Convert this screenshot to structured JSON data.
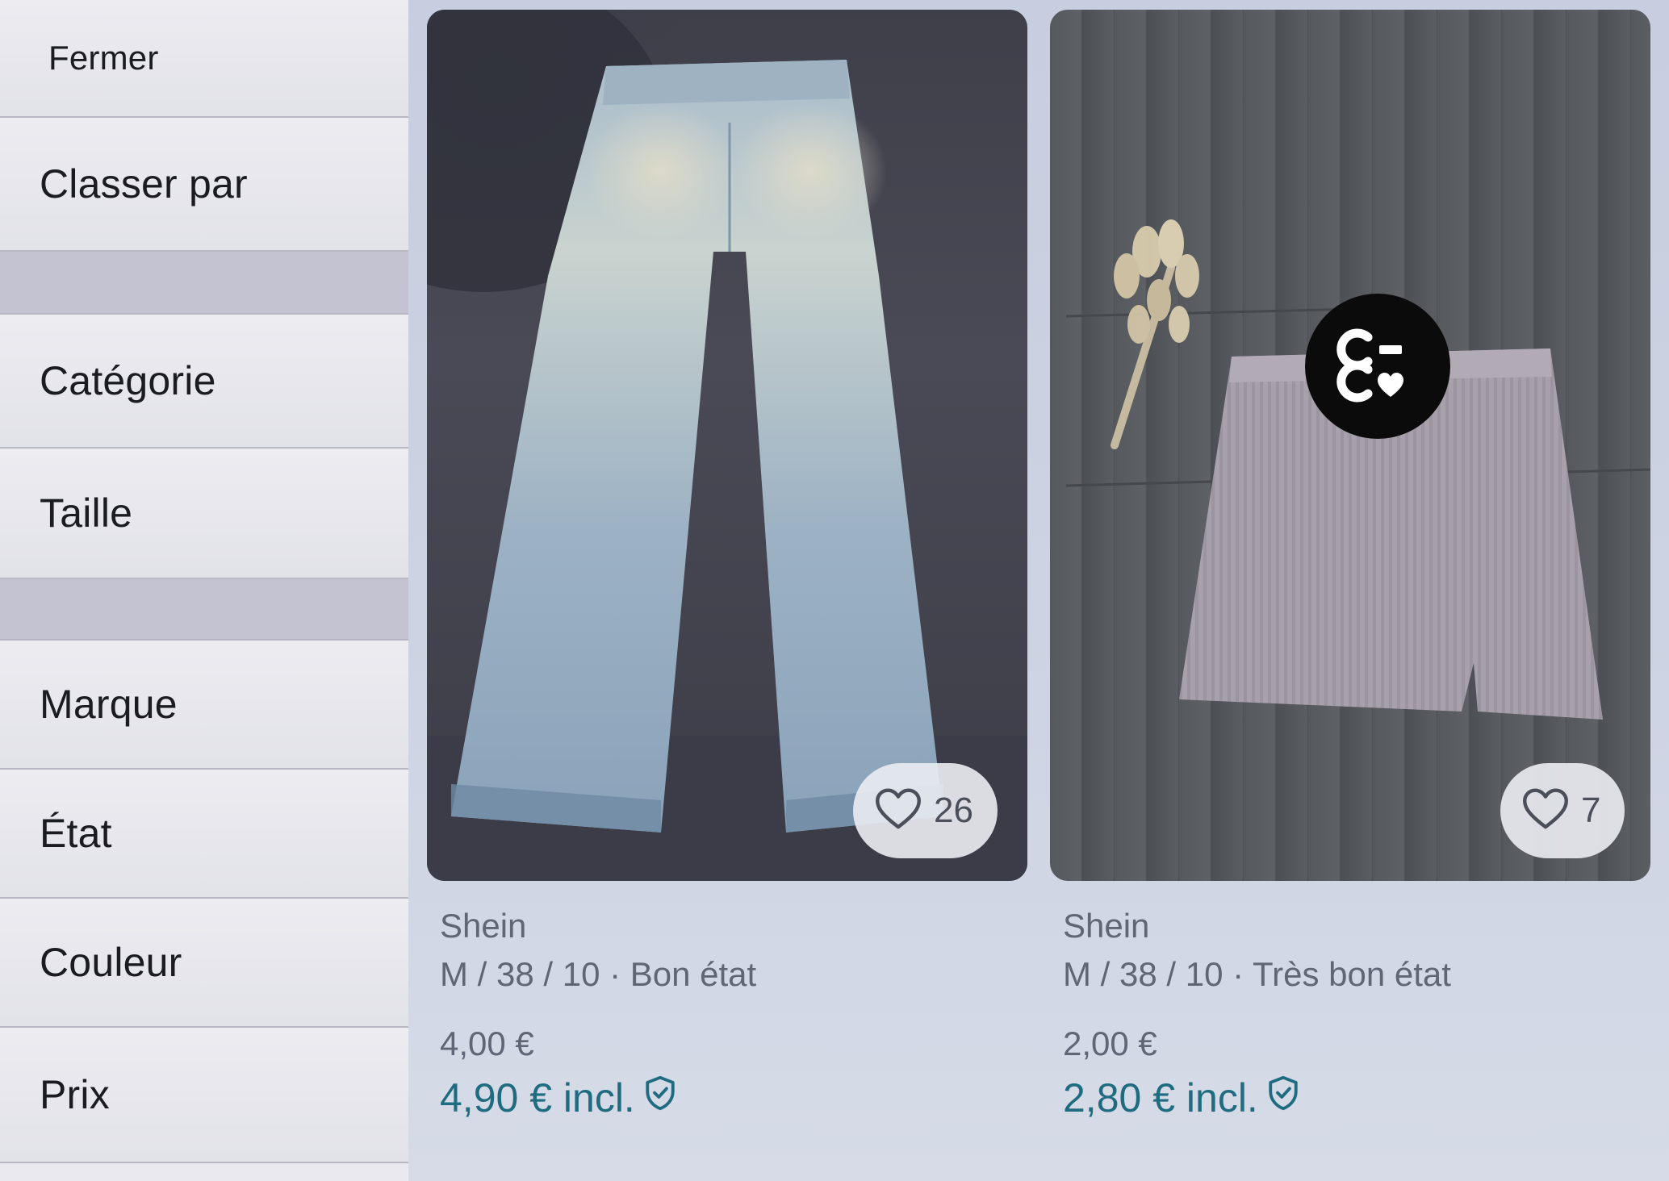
{
  "sidebar": {
    "close_label": "Fermer",
    "sort_label": "Classer par",
    "filters": [
      "Catégorie",
      "Taille",
      "Marque",
      "État",
      "Couleur",
      "Prix"
    ]
  },
  "products": [
    {
      "brand": "Shein",
      "details": "M / 38 / 10 · Bon état",
      "price": "4,00 €",
      "price_incl": "4,90 € incl.",
      "likes": "26",
      "photo_subject": "light-wash wide-leg jeans"
    },
    {
      "brand": "Shein",
      "details": "M / 38 / 10 · Très bon état",
      "price": "2,00 €",
      "price_incl": "2,80 € incl.",
      "likes": "7",
      "photo_subject": "pink corduroy mini skirt"
    }
  ],
  "colors": {
    "accent": "#1f6c80",
    "sidebar_bg": "#e9e9ef",
    "separator": "#c3c3d2"
  }
}
